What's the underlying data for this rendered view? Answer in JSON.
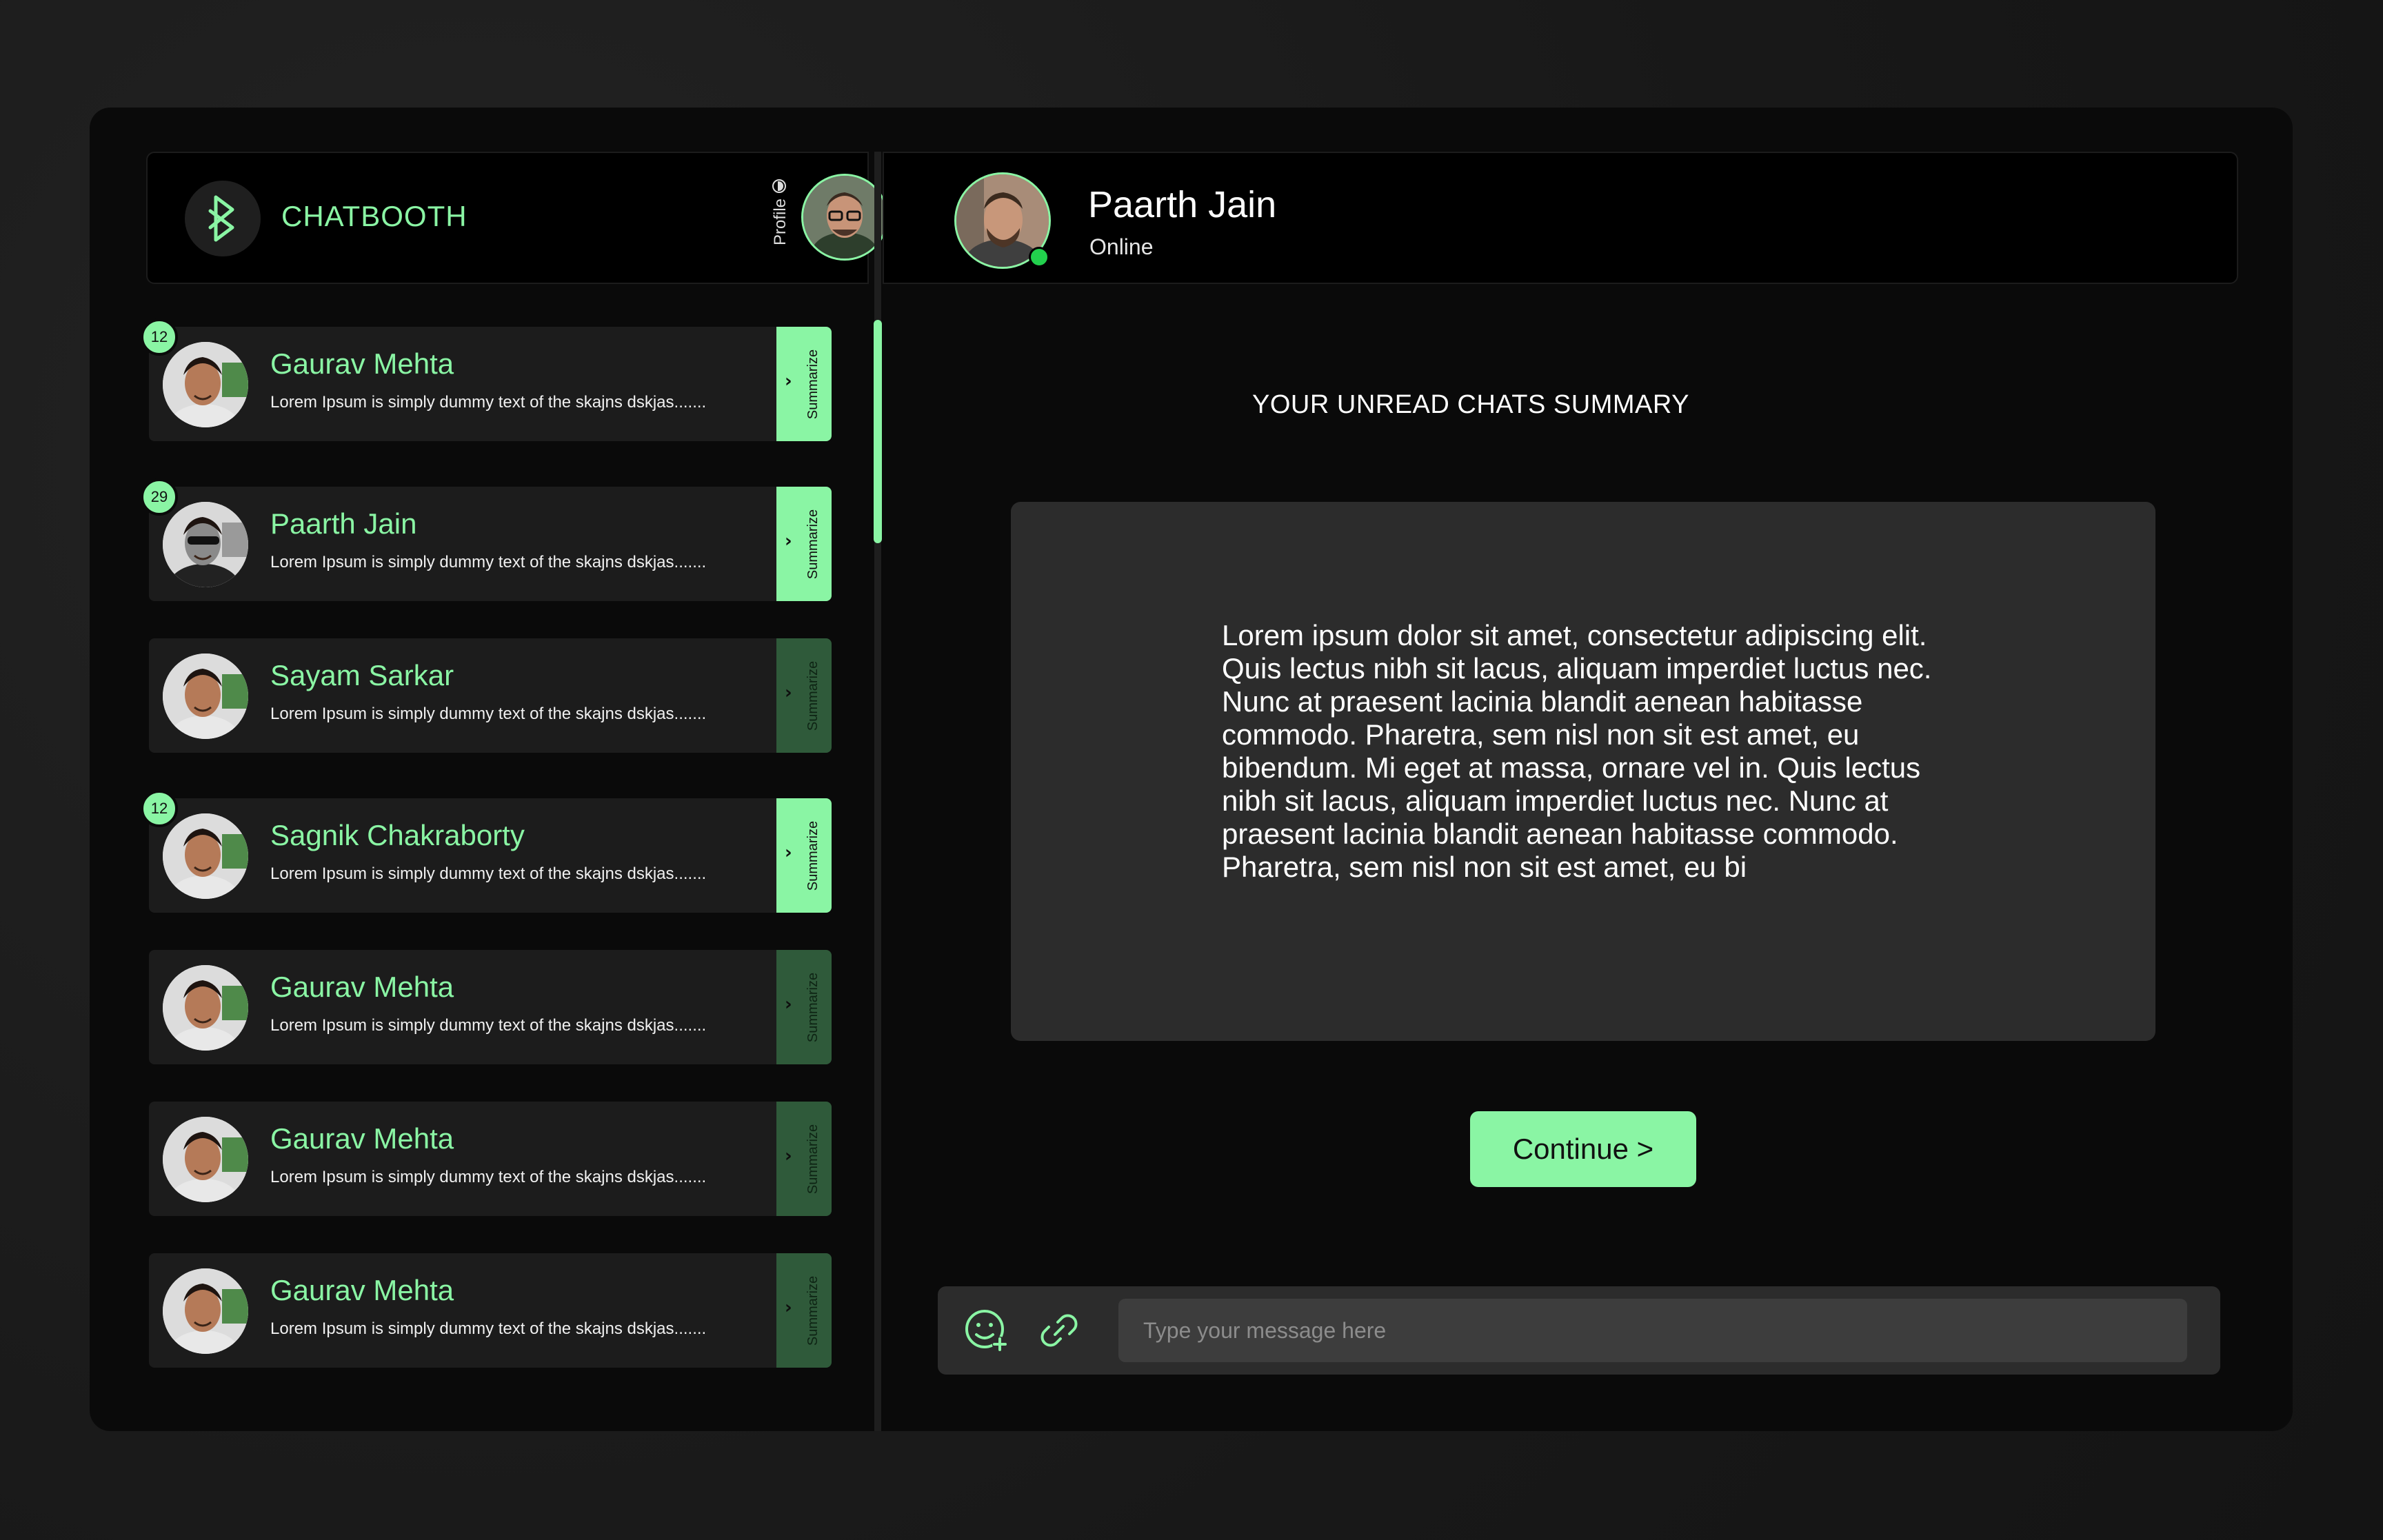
{
  "brand": {
    "name": "CHATBOOTH",
    "logo_icon": "bluetooth-b-icon",
    "accent": "#8af5a4"
  },
  "profile": {
    "label": "Profile",
    "icon": "profile-dot-icon"
  },
  "contact": {
    "name": "Paarth Jain",
    "status": "Online",
    "status_color": "#22d04d"
  },
  "chats": [
    {
      "name": "Gaurav Mehta",
      "preview": "Lorem Ipsum is simply dummy text of the skajns dskjas.......",
      "badge": "12",
      "summarize_label": "Summarize",
      "summarize_active": true
    },
    {
      "name": "Paarth Jain",
      "preview": "Lorem Ipsum is simply dummy text of the skajns dskjas.......",
      "badge": "29",
      "summarize_label": "Summarize",
      "summarize_active": true
    },
    {
      "name": "Sayam Sarkar",
      "preview": "Lorem Ipsum is simply dummy text of the skajns dskjas.......",
      "badge": "",
      "summarize_label": "Summarize",
      "summarize_active": false
    },
    {
      "name": "Sagnik Chakraborty",
      "preview": "Lorem Ipsum is simply dummy text of the skajns dskjas.......",
      "badge": "12",
      "summarize_label": "Summarize",
      "summarize_active": true
    },
    {
      "name": "Gaurav Mehta",
      "preview": "Lorem Ipsum is simply dummy text of the skajns dskjas.......",
      "badge": "",
      "summarize_label": "Summarize",
      "summarize_active": false
    },
    {
      "name": "Gaurav Mehta",
      "preview": "Lorem Ipsum is simply dummy text of the skajns dskjas.......",
      "badge": "",
      "summarize_label": "Summarize",
      "summarize_active": false
    },
    {
      "name": "Gaurav Mehta",
      "preview": "Lorem Ipsum is simply dummy text of the skajns dskjas.......",
      "badge": "",
      "summarize_label": "Summarize",
      "summarize_active": false
    }
  ],
  "summary": {
    "title": "YOUR UNREAD CHATS SUMMARY",
    "text": "Lorem ipsum dolor sit amet, consectetur adipiscing elit. Quis lectus nibh sit lacus, aliquam imperdiet luctus nec. Nunc at praesent lacinia blandit aenean habitasse commodo. Pharetra, sem nisl non sit est amet, eu bibendum. Mi eget at massa, ornare vel in. Quis lectus nibh sit lacus, aliquam imperdiet luctus nec. Nunc at praesent lacinia blandit aenean habitasse commodo. Pharetra, sem nisl non sit est amet, eu bi"
  },
  "continue_label": "Continue >",
  "composer": {
    "placeholder": "Type your message here",
    "emoji_icon": "emoji-add-icon",
    "attach_icon": "link-icon"
  }
}
